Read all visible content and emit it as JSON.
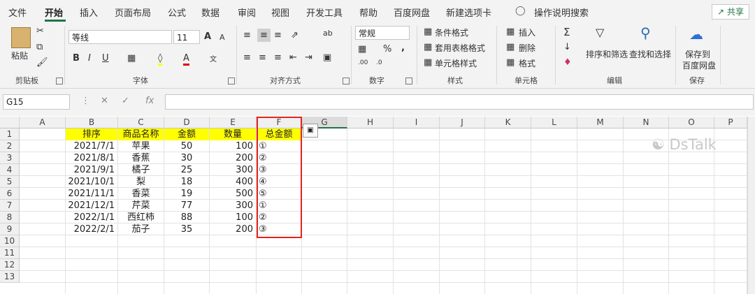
{
  "tabs": [
    "文件",
    "开始",
    "插入",
    "页面布局",
    "公式",
    "数据",
    "审阅",
    "视图",
    "开发工具",
    "帮助",
    "百度网盘",
    "新建选项卡"
  ],
  "active_tab": "开始",
  "tell_me": "操作说明搜索",
  "share_label": "共享",
  "ribbon": {
    "clipboard": {
      "paste": "粘贴",
      "label": "剪贴板"
    },
    "font": {
      "name": "等线",
      "size": "11",
      "label": "字体",
      "bold": "B",
      "italic": "I",
      "underline": "U",
      "grow": "A",
      "shrink": "A"
    },
    "alignment": {
      "label": "对齐方式"
    },
    "number": {
      "format": "常规",
      "label": "数字",
      "percent": "%",
      "comma": ","
    },
    "styles": {
      "cond": "条件格式",
      "table": "套用表格格式",
      "cell": "单元格样式",
      "label": "样式"
    },
    "cells": {
      "insert": "插入",
      "delete": "删除",
      "format": "格式",
      "label": "单元格"
    },
    "editing": {
      "sort": "排序和筛选",
      "find": "查找和选择",
      "label": "编辑"
    },
    "save": {
      "btn1": "保存到",
      "btn2": "百度网盘",
      "label": "保存"
    }
  },
  "formula_bar": {
    "name_box": "G15",
    "fx": "fx",
    "value": ""
  },
  "columns": [
    "A",
    "B",
    "C",
    "D",
    "E",
    "F",
    "G",
    "H",
    "I",
    "J",
    "K",
    "L",
    "M",
    "N",
    "O",
    "P"
  ],
  "rows": [
    "1",
    "2",
    "3",
    "4",
    "5",
    "6",
    "7",
    "8",
    "9",
    "10",
    "11",
    "12",
    "13"
  ],
  "table": {
    "headers": [
      "排序",
      "商品名称",
      "金额",
      "数量",
      "总金额"
    ],
    "data": [
      [
        "2021/7/1",
        "苹果",
        "50",
        "100",
        "①"
      ],
      [
        "2021/8/1",
        "香蕉",
        "30",
        "200",
        "②"
      ],
      [
        "2021/9/1",
        "橘子",
        "25",
        "300",
        "③"
      ],
      [
        "2021/10/1",
        "梨",
        "18",
        "400",
        "④"
      ],
      [
        "2021/11/1",
        "香菜",
        "19",
        "500",
        "⑤"
      ],
      [
        "2021/12/1",
        "芹菜",
        "77",
        "300",
        "①"
      ],
      [
        "2022/1/1",
        "西红柿",
        "88",
        "100",
        "②"
      ],
      [
        "2022/2/1",
        "茄子",
        "35",
        "200",
        "③"
      ]
    ]
  },
  "watermark": "DsTalk",
  "colors": {
    "accent": "#217346",
    "highlight": "#ffff00",
    "selection_border": "#e5221d"
  }
}
